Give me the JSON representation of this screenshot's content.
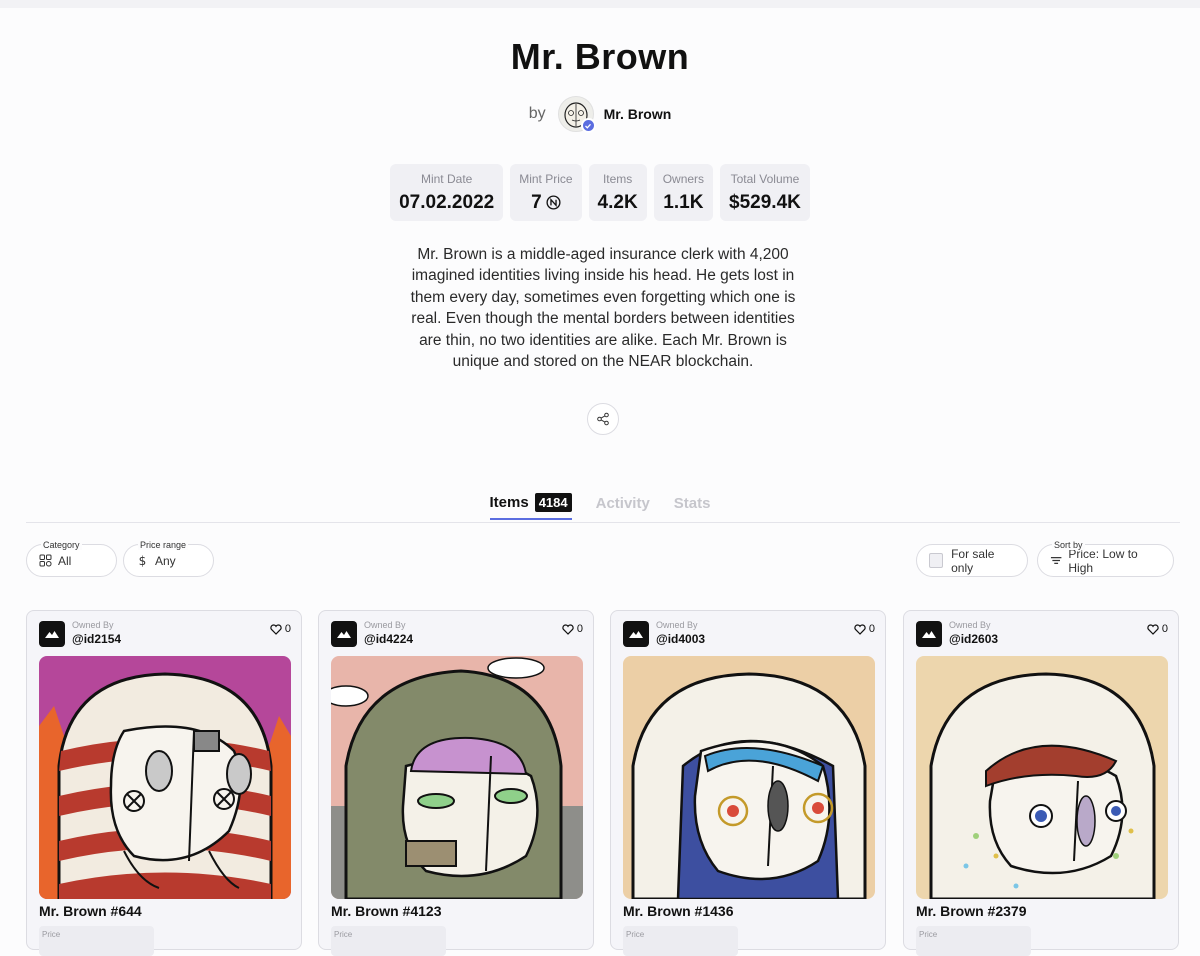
{
  "header": {
    "title": "Mr. Brown",
    "by_label": "by",
    "creator_name": "Mr. Brown"
  },
  "stats": [
    {
      "label": "Mint Date",
      "value": "07.02.2022"
    },
    {
      "label": "Mint Price",
      "value": "7"
    },
    {
      "label": "Items",
      "value": "4.2K"
    },
    {
      "label": "Owners",
      "value": "1.1K"
    },
    {
      "label": "Total Volume",
      "value": "$529.4K"
    }
  ],
  "description": "Mr. Brown is a middle-aged insurance clerk with 4,200 imagined identities living inside his head. He gets lost in them every day, sometimes even forgetting which one is real. Even though the mental borders between identities are thin, no two identities are alike. Each Mr. Brown is unique and stored on the NEAR blockchain.",
  "tabs": [
    {
      "label": "Items",
      "count": "4184",
      "active": true
    },
    {
      "label": "Activity"
    },
    {
      "label": "Stats"
    }
  ],
  "filters": {
    "category": {
      "legend": "Category",
      "value": "All"
    },
    "price_range": {
      "legend": "Price range",
      "value": "Any"
    },
    "for_sale_label": "For sale only",
    "sort": {
      "legend": "Sort by",
      "value": "Price: Low to High"
    }
  },
  "cards": [
    {
      "owned_label": "Owned By",
      "owner": "@id2154",
      "likes": "0",
      "name": "Mr. Brown #644",
      "price_label": "Price",
      "bg": "#b5479a"
    },
    {
      "owned_label": "Owned By",
      "owner": "@id4224",
      "likes": "0",
      "name": "Mr. Brown #4123",
      "price_label": "Price",
      "bg": "#e8b5aa"
    },
    {
      "owned_label": "Owned By",
      "owner": "@id4003",
      "likes": "0",
      "name": "Mr. Brown #1436",
      "price_label": "Price",
      "bg": "#eccfa6"
    },
    {
      "owned_label": "Owned By",
      "owner": "@id2603",
      "likes": "0",
      "name": "Mr. Brown #2379",
      "price_label": "Price",
      "bg": "#edd6ad"
    }
  ],
  "colors": {
    "accent": "#5b6de0",
    "tab_badge": "#111111"
  },
  "icons": [
    "verified-icon",
    "near-icon",
    "share-icon",
    "category-icon",
    "dollar-icon",
    "sort-icon",
    "heart-icon",
    "mountain-logo-icon"
  ]
}
